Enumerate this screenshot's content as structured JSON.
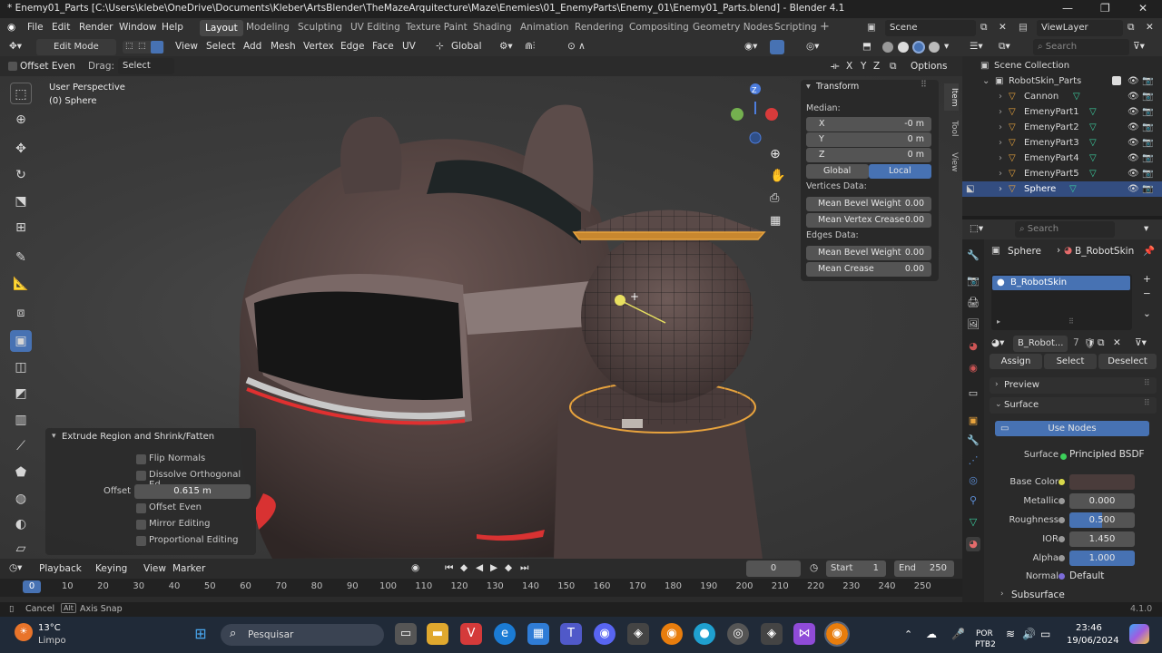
{
  "window": {
    "title": "* Enemy01_Parts [C:\\Users\\klebe\\OneDrive\\Documents\\Kleber\\ArtsBlender\\TheMazeArquitecture\\Maze\\Enemies\\01_EnemyParts\\Enemy_01\\Enemy01_Parts.blend] - Blender 4.1"
  },
  "menu": [
    "File",
    "Edit",
    "Render",
    "Window",
    "Help"
  ],
  "workspaces": [
    "Layout",
    "Modeling",
    "Sculpting",
    "UV Editing",
    "Texture Paint",
    "Shading",
    "Animation",
    "Rendering",
    "Compositing",
    "Geometry Nodes",
    "Scripting"
  ],
  "active_workspace": "Layout",
  "scene": "Scene",
  "view_layer": "ViewLayer",
  "viewport_header": {
    "mode": "Edit Mode",
    "menus": [
      "View",
      "Select",
      "Add",
      "Mesh",
      "Vertex",
      "Edge",
      "Face",
      "UV"
    ],
    "orientation": "Global"
  },
  "tool_header": {
    "offset_even": "Offset Even",
    "drag_label": "Drag:",
    "drag_value": "Select Box",
    "axes": [
      "X",
      "Y",
      "Z"
    ],
    "options": "Options"
  },
  "viewport": {
    "perspective": "User Perspective",
    "object": "(0) Sphere"
  },
  "npanel": {
    "section": "Transform",
    "median": "Median:",
    "x_label": "X",
    "x_value": "-0 m",
    "y_label": "Y",
    "y_value": "0 m",
    "z_label": "Z",
    "z_value": "0 m",
    "global": "Global",
    "local": "Local",
    "vertices_data": "Vertices Data:",
    "mean_bevel_weight_label": "Mean Bevel Weight",
    "mean_bevel_weight_v": "0.00",
    "mean_vertex_crease_label": "Mean Vertex Crease",
    "mean_vertex_crease": "0.00",
    "edges_data": "Edges Data:",
    "mean_bevel_weight_e": "0.00",
    "mean_crease_label": "Mean Crease",
    "mean_crease": "0.00",
    "tabs": [
      "Item",
      "Tool",
      "View"
    ]
  },
  "operator_panel": {
    "title": "Extrude Region and Shrink/Fatten",
    "flip_normals": "Flip Normals",
    "dissolve": "Dissolve Orthogonal Ed...",
    "offset_label": "Offset",
    "offset_value": "0.615 m",
    "offset_even": "Offset Even",
    "mirror_editing": "Mirror Editing",
    "proportional_editing": "Proportional Editing"
  },
  "timeline": {
    "playback": "Playback",
    "keying": "Keying",
    "view": "View",
    "marker": "Marker",
    "current_frame": "0",
    "start_label": "Start",
    "start": "1",
    "end_label": "End",
    "end": "250",
    "ticks": [
      "0",
      "10",
      "20",
      "30",
      "40",
      "50",
      "60",
      "70",
      "80",
      "90",
      "100",
      "110",
      "120",
      "130",
      "140",
      "150",
      "160",
      "170",
      "180",
      "190",
      "200",
      "210",
      "220",
      "230",
      "240",
      "250"
    ]
  },
  "statusbar": {
    "cancel": "Cancel",
    "alt": "Alt",
    "axis_snap": "Axis Snap",
    "version": "4.1.0"
  },
  "outliner": {
    "search_placeholder": "Search",
    "items": [
      {
        "name": "Scene Collection",
        "level": 0
      },
      {
        "name": "RobotSkin_Parts",
        "level": 1
      },
      {
        "name": "Cannon",
        "level": 2
      },
      {
        "name": "EmenyPart1",
        "level": 2
      },
      {
        "name": "EmenyPart2",
        "level": 2
      },
      {
        "name": "EmenyPart3",
        "level": 2
      },
      {
        "name": "EmenyPart4",
        "level": 2
      },
      {
        "name": "EmenyPart5",
        "level": 2
      },
      {
        "name": "Sphere",
        "level": 2
      }
    ]
  },
  "properties": {
    "search_placeholder": "Search",
    "breadcrumb_object": "Sphere",
    "breadcrumb_material": "B_RobotSkin",
    "slot": "B_RobotSkin",
    "material_name": "B_Robot...",
    "users": "7",
    "assign": "Assign",
    "select": "Select",
    "deselect": "Deselect",
    "preview": "Preview",
    "surface_section": "Surface",
    "use_nodes": "Use Nodes",
    "surface_label": "Surface",
    "surface_value": "Principled BSDF",
    "base_color_label": "Base Color",
    "metallic_label": "Metallic",
    "metallic": "0.000",
    "roughness_label": "Roughness",
    "roughness": "0.500",
    "ior_label": "IOR",
    "ior": "1.450",
    "alpha_label": "Alpha",
    "alpha": "1.000",
    "normal_label": "Normal",
    "normal_value": "Default",
    "subsurface": "Subsurface"
  },
  "taskbar": {
    "temp": "13°C",
    "weather": "Limpo",
    "search": "Pesquisar",
    "lang1": "POR",
    "lang2": "PTB2",
    "time": "23:46",
    "date": "19/06/2024"
  },
  "colors": {
    "accent": "#4772b3",
    "selection": "#e8a33d",
    "roughness_fill": "#4772b3"
  }
}
